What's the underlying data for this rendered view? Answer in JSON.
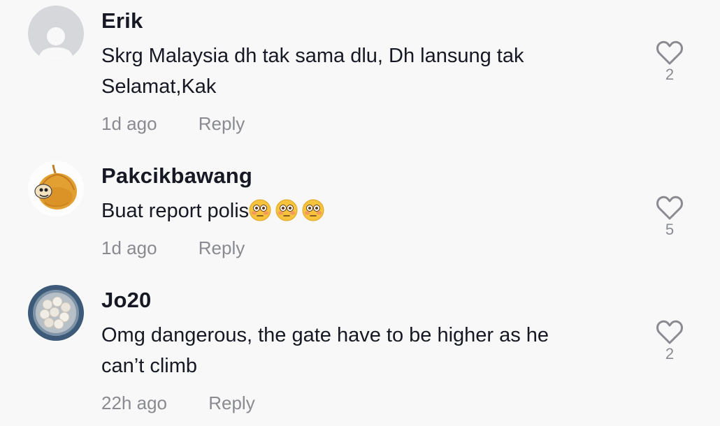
{
  "comments": [
    {
      "username": "Erik",
      "text_line1": "Skrg Malaysia dh tak sama dlu, Dh lansung tak",
      "text_line2": "Selamat,Kak",
      "time": "1d ago",
      "reply_label": "Reply",
      "likes": "2",
      "avatar_icon": "default-user-avatar-icon"
    },
    {
      "username": "Pakcikbawang",
      "text": "Buat report polis",
      "emojis": [
        "flushed-face",
        "flushed-face",
        "flushed-face"
      ],
      "time": "1d ago",
      "reply_label": "Reply",
      "likes": "5",
      "avatar_icon": "onion-avatar-icon"
    },
    {
      "username": "Jo20",
      "text_line1": "Omg dangerous, the gate have to be higher as he",
      "text_line2": "can’t climb",
      "time": "22h ago",
      "reply_label": "Reply",
      "likes": "2",
      "avatar_icon": "garlic-bowl-avatar-icon"
    }
  ],
  "colors": {
    "background": "#f8f8f8",
    "text": "#161823",
    "muted": "#8a8b91"
  }
}
